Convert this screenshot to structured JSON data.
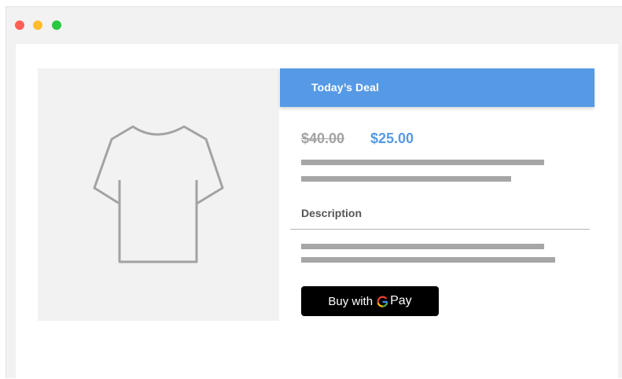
{
  "window": {
    "controls": [
      {
        "name": "close",
        "color": "#ff5f57"
      },
      {
        "name": "minimize",
        "color": "#ffbd2e"
      },
      {
        "name": "maximize",
        "color": "#28c940"
      }
    ]
  },
  "product": {
    "image_icon": "tshirt-icon"
  },
  "deal": {
    "title": "Today’s Deal",
    "old_price": "$40.00",
    "new_price": "$25.00",
    "description_label": "Description"
  },
  "pay_button": {
    "buy_label": "Buy with",
    "pay_label": "Pay",
    "icon": "google-g-icon"
  },
  "colors": {
    "accent": "#5699e4",
    "strikethrough_price": "#a3a3a3",
    "placeholder_line": "#a6a6a6",
    "button_bg": "#000000"
  }
}
